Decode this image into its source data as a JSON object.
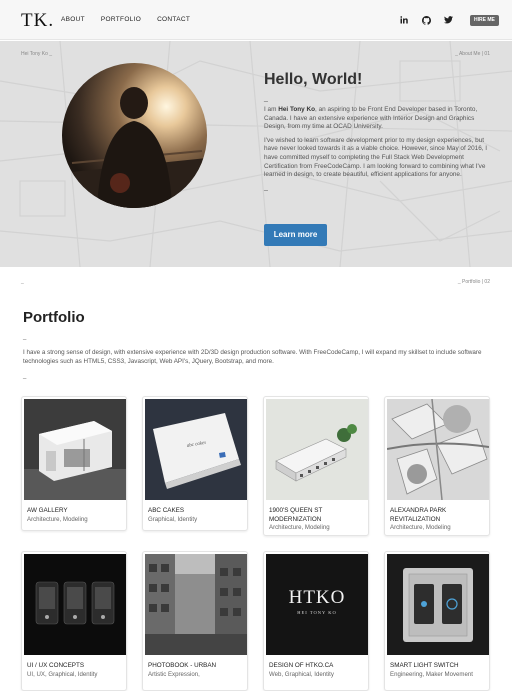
{
  "nav": {
    "logo": "TK.",
    "links": [
      "ABOUT",
      "PORTFOLIO",
      "CONTACT"
    ],
    "social_icons": [
      "linkedin-icon",
      "github-icon",
      "twitter-icon"
    ],
    "hire_label": "HIRE ME"
  },
  "hero": {
    "tag_left": "Hei Tony Ko _",
    "tag_right": "_ About Me | 01",
    "title": "Hello, World!",
    "dash1": "_",
    "para1_prefix": "I am ",
    "para1_name": "Hei Tony Ko",
    "para1_rest": ", an aspiring to be Front End Developer based in Toronto, Canada. I have an extensive experience with Interior Design and Graphics Design, from my time at OCAD University.",
    "para2": "I've wished to learn software development prior to my design experiences, but have never looked towards it as a viable choice. However, since May of 2016, I have committed myself to completing the Full Stack Web Development Certification from FreeCodeCamp. I am looking forward to combining what I've learned in design, to create beautiful, efficient applications for anyone.",
    "dash2": "_",
    "button": "Learn more"
  },
  "portfolio": {
    "tag_left": "_",
    "tag_right": "_ Portfolio | 02",
    "title": "Portfolio",
    "dash1": "_",
    "description": "I have a strong sense of design, with extensive experience with 2D/3D design production software. With FreeCodeCamp, I will expand my skillset to include software technologies such as HTML5, CSS3, Javascript, Web API's, JQuery, Bootstrap, and more.",
    "dash2": "_",
    "cards": [
      {
        "title": "AW GALLERY",
        "subtitle": "Architecture, Modeling"
      },
      {
        "title": "ABC CAKES",
        "subtitle": "Graphical, Identity"
      },
      {
        "title": "1900'S QUEEN ST MODERNIZATION",
        "subtitle": "Architecture, Modeling"
      },
      {
        "title": "ALEXANDRA PARK REVITALIZATION",
        "subtitle": "Architecture, Modeling"
      },
      {
        "title": "UI / UX CONCEPTS",
        "subtitle": "UI, UX, Graphical, Identity"
      },
      {
        "title": "PHOTOBOOK - URBAN",
        "subtitle": "Artistic Expression,"
      },
      {
        "title": "DESIGN OF HTKO.CA",
        "subtitle": "Web, Graphical, Identity"
      },
      {
        "title": "SMART LIGHT SWITCH",
        "subtitle": "Engineering, Maker Movement"
      }
    ],
    "htko_logo": "HTKO",
    "htko_logo_sub": "HEI TONY KO"
  },
  "colors": {
    "accent": "#337ab7",
    "hero_bg": "#e2e2e2",
    "nav_bg": "#f7f7f7"
  }
}
